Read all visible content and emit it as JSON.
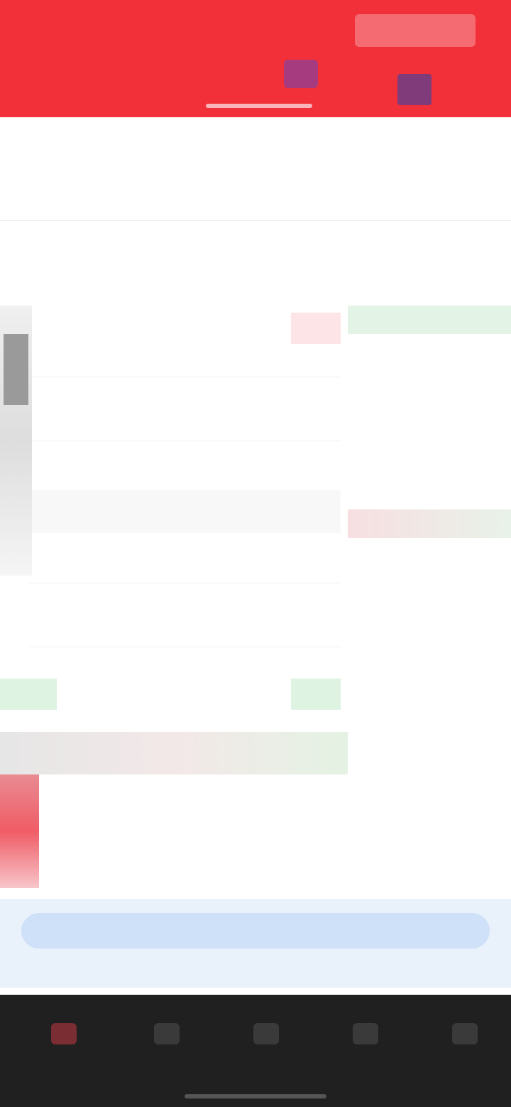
{
  "header": {
    "title": "",
    "right_button": "",
    "tabs": [
      {
        "label": ""
      },
      {
        "label": ""
      },
      {
        "label": ""
      },
      {
        "label": ""
      },
      {
        "label": ""
      }
    ]
  },
  "quote": {
    "price": "",
    "change": "",
    "cols": [
      "",
      "",
      "",
      "",
      ""
    ]
  },
  "info_cells": [
    "",
    "",
    "",
    "",
    "",
    "",
    ""
  ],
  "section_label": "",
  "chart_label": "",
  "book_rows": [
    {
      "p": "",
      "r": "",
      "g": ""
    },
    {
      "p": "",
      "r": "",
      "g": ""
    },
    {
      "p": "",
      "r": "",
      "g": ""
    },
    {
      "p": "",
      "r": "",
      "g": ""
    },
    {
      "p": "",
      "r": "",
      "g": ""
    },
    {
      "p": "",
      "r": "",
      "g": ""
    },
    {
      "p": "",
      "r": "",
      "g": ""
    },
    {
      "p": "",
      "r": "",
      "g": ""
    },
    {
      "p": "",
      "r": "",
      "g": ""
    },
    {
      "p": "",
      "r": "",
      "g": ""
    },
    {
      "p": "",
      "r": "",
      "g": ""
    },
    {
      "p": "",
      "r": "",
      "g": ""
    },
    {
      "p": "",
      "r": "",
      "g": ""
    },
    {
      "p": "",
      "r": "",
      "g": ""
    },
    {
      "p": "",
      "r": "",
      "g": ""
    },
    {
      "p": "",
      "r": "",
      "g": ""
    },
    {
      "p": "",
      "r": "",
      "g": ""
    },
    {
      "p": "",
      "r": "",
      "g": ""
    },
    {
      "p": "",
      "r": "",
      "g": ""
    },
    {
      "p": "",
      "r": "",
      "g": ""
    }
  ],
  "lower_strip_text": "",
  "ad_text": "",
  "nav": {
    "items": [
      {
        "label": "",
        "icon": "home-icon"
      },
      {
        "label": "",
        "icon": "market-icon"
      },
      {
        "label": "",
        "icon": "trade-icon"
      },
      {
        "label": "",
        "icon": "news-icon"
      },
      {
        "label": "",
        "icon": "profile-icon"
      }
    ]
  },
  "colors": {
    "header": "#f2303a",
    "up": "#e77580",
    "down": "#6ab67b",
    "nav_bg": "#202020"
  }
}
